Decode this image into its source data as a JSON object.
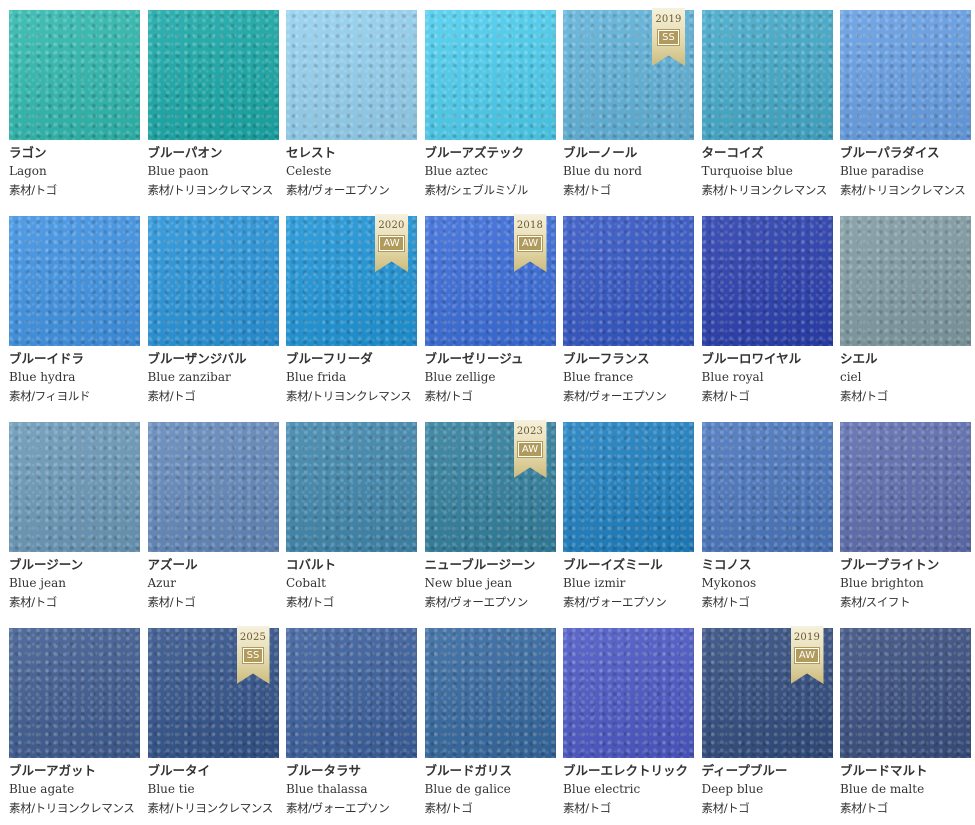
{
  "swatches": [
    {
      "ja": "ラゴン",
      "en": "Lagon",
      "material": "素材/トゴ",
      "color": "#2fb8ae"
    },
    {
      "ja": "ブルーパオン",
      "en": "Blue paon",
      "material": "素材/トリヨンクレマンス",
      "color": "#1aa8a8"
    },
    {
      "ja": "セレスト",
      "en": "Celeste",
      "material": "素材/ヴォーエプソン",
      "color": "#93d0ef"
    },
    {
      "ja": "ブルーアズテック",
      "en": "Blue aztec",
      "material": "素材/シェブルミゾル",
      "color": "#4ccdee"
    },
    {
      "ja": "ブルーノール",
      "en": "Blue du nord",
      "material": "素材/トゴ",
      "color": "#5fb1d8",
      "badge": {
        "year": "2019",
        "season": "SS"
      }
    },
    {
      "ja": "ターコイズ",
      "en": "Turquoise blue",
      "material": "素材/トリヨンクレマンス",
      "color": "#43a9c9"
    },
    {
      "ja": "ブルーパラダイス",
      "en": "Blue paradise",
      "material": "素材/トリヨンクレマンス",
      "color": "#669ee3"
    },
    {
      "ja": "ブルーイドラ",
      "en": "Blue hydra",
      "material": "素材/フィヨルド",
      "color": "#3f92e2"
    },
    {
      "ja": "ブルーザンジバル",
      "en": "Blue zanzibar",
      "material": "素材/トゴ",
      "color": "#2893d8"
    },
    {
      "ja": "ブルーフリーダ",
      "en": "Blue frida",
      "material": "素材/トリヨンクレマンス",
      "color": "#1e94d6",
      "badge": {
        "year": "2020",
        "season": "AW"
      }
    },
    {
      "ja": "ブルーゼリージュ",
      "en": "Blue zellige",
      "material": "素材/トゴ",
      "color": "#3a6cd8",
      "badge": {
        "year": "2018",
        "season": "AW"
      }
    },
    {
      "ja": "ブルーフランス",
      "en": "Blue france",
      "material": "素材/ヴォーエプソン",
      "color": "#3456c4"
    },
    {
      "ja": "ブルーロワイヤル",
      "en": "Blue royal",
      "material": "素材/トゴ",
      "color": "#2a3fae"
    },
    {
      "ja": "シエル",
      "en": "ciel",
      "material": "素材/トゴ",
      "color": "#7f9aa2"
    },
    {
      "ja": "ブルージーン",
      "en": "Blue jean",
      "material": "素材/トゴ",
      "color": "#6a98b8"
    },
    {
      "ja": "アズール",
      "en": "Azur",
      "material": "素材/トゴ",
      "color": "#6388ba"
    },
    {
      "ja": "コバルト",
      "en": "Cobalt",
      "material": "素材/トゴ",
      "color": "#3f86ac"
    },
    {
      "ja": "ニューブルージーン",
      "en": "New blue jean",
      "material": "素材/ヴォーエプソン",
      "color": "#327f9d",
      "badge": {
        "year": "2023",
        "season": "AW"
      }
    },
    {
      "ja": "ブルーイズミール",
      "en": "Blue izmir",
      "material": "素材/ヴォーエプソン",
      "color": "#1e7fc0"
    },
    {
      "ja": "ミコノス",
      "en": "Mykonos",
      "material": "素材/トゴ",
      "color": "#4a76bd"
    },
    {
      "ja": "ブルーブライトン",
      "en": "Blue brighton",
      "material": "素材/スイフト",
      "color": "#5d6dae"
    },
    {
      "ja": "ブルーアガット",
      "en": "Blue agate",
      "material": "素材/トリヨンクレマンス",
      "color": "#3f5d91"
    },
    {
      "ja": "ブルータイ",
      "en": "Blue tie",
      "material": "素材/トリヨンクレマンス",
      "color": "#33538a",
      "badge": {
        "year": "2025",
        "season": "SS"
      }
    },
    {
      "ja": "ブルータラサ",
      "en": "Blue thalassa",
      "material": "素材/ヴォーエプソン",
      "color": "#3b5f9c"
    },
    {
      "ja": "ブルードガリス",
      "en": "Blue de galice",
      "material": "素材/トゴ",
      "color": "#35689f"
    },
    {
      "ja": "ブルーエレクトリック",
      "en": "Blue electric",
      "material": "素材/トゴ",
      "color": "#4b58c4"
    },
    {
      "ja": "ディープブルー",
      "en": "Deep blue",
      "material": "素材/トゴ",
      "color": "#314c7e",
      "badge": {
        "year": "2019",
        "season": "AW"
      }
    },
    {
      "ja": "ブルードマルト",
      "en": "Blue de malte",
      "material": "素材/トゴ",
      "color": "#3a4f80"
    }
  ]
}
